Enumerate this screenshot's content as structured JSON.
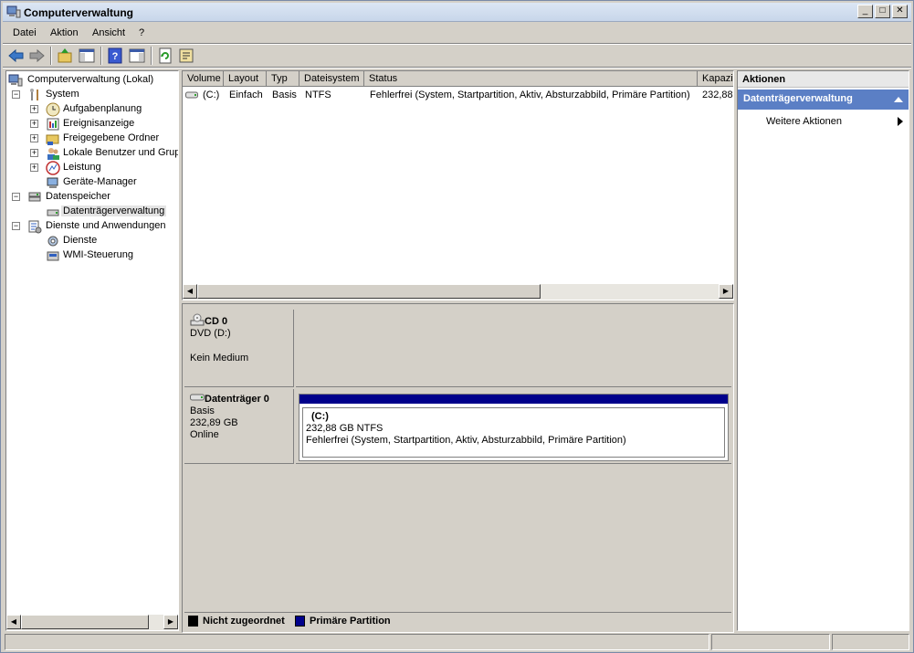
{
  "window": {
    "title": "Computerverwaltung"
  },
  "controls": {
    "minimize": "_",
    "maximize": "□",
    "close": "✕"
  },
  "menu": [
    "Datei",
    "Aktion",
    "Ansicht",
    "?"
  ],
  "tree": {
    "root": "Computerverwaltung (Lokal)",
    "system": "System",
    "aufgabenplanung": "Aufgabenplanung",
    "ereignisanzeige": "Ereignisanzeige",
    "freigegebene_ordner": "Freigegebene Ordner",
    "lokale_benutzer": "Lokale Benutzer und Grupp",
    "leistung": "Leistung",
    "geraete_manager": "Geräte-Manager",
    "datenspeicher": "Datenspeicher",
    "datentraegerverwaltung": "Datenträgerverwaltung",
    "dienste_anwendungen": "Dienste und Anwendungen",
    "dienste": "Dienste",
    "wmi": "WMI-Steuerung"
  },
  "volume_list": {
    "columns": [
      "Volume",
      "Layout",
      "Typ",
      "Dateisystem",
      "Status",
      "Kapazi"
    ],
    "rows": [
      {
        "volume": "(C:)",
        "layout": "Einfach",
        "typ": "Basis",
        "dateisystem": "NTFS",
        "status": "Fehlerfrei (System, Startpartition, Aktiv, Absturzabbild, Primäre Partition)",
        "kapazitaet": "232,88"
      }
    ]
  },
  "disks": {
    "cd0": {
      "name": "CD 0",
      "type": "DVD (D:)",
      "status": "Kein Medium"
    },
    "disk0": {
      "name": "Datenträger 0",
      "type": "Basis",
      "size": "232,89 GB",
      "status": "Online",
      "partition": {
        "label": "(C:)",
        "size_fs": "232,88 GB NTFS",
        "status": "Fehlerfrei (System, Startpartition, Aktiv, Absturzabbild, Primäre Partition)"
      }
    }
  },
  "legend": [
    {
      "label": "Nicht zugeordnet",
      "color": "#000000"
    },
    {
      "label": "Primäre Partition",
      "color": "#00008b"
    }
  ],
  "actions": {
    "header": "Aktionen",
    "section": "Datenträgerverwaltung",
    "item": "Weitere Aktionen"
  },
  "colors": {
    "partition_bar": "#00008b",
    "action_section": "#5b7fc5"
  }
}
